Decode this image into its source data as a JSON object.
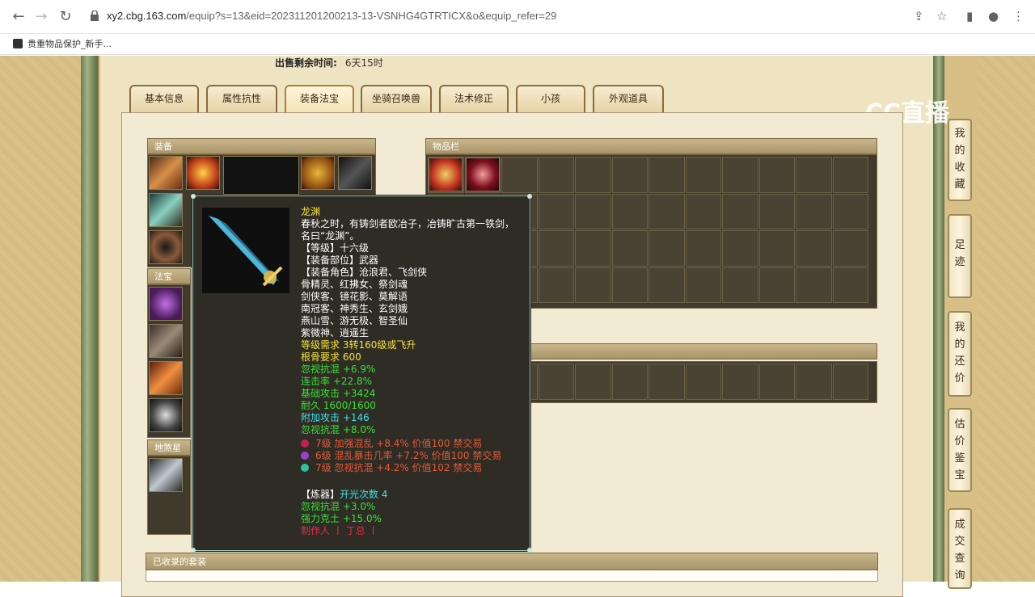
{
  "browser": {
    "url_host": "xy2.cbg.163.com",
    "url_path": "/equip?s=13&eid=202311201200213-13-VSNHG4GTRTICX&o&equip_refer=29",
    "bookmark": "贵重物品保护_新手..."
  },
  "sale": {
    "label": "出售剩余时间:",
    "value": "6天15时"
  },
  "tabs": [
    "基本信息",
    "属性抗性",
    "装备法宝",
    "坐骑召唤兽",
    "法术修正",
    "小孩",
    "外观道具"
  ],
  "panels": {
    "equipment": "装备",
    "fabao": "法宝",
    "disha": "地煞星",
    "inventory": "物品栏",
    "suits": "已收录的套装"
  },
  "tooltip": {
    "name": "龙渊",
    "desc_1": "春秋之时，有铸剑者欧冶子，冶铸旷古第一铁剑，",
    "desc_2": "名曰“龙渊”。",
    "level": "【等级】十六级",
    "slot": "【装备部位】武器",
    "roles": "【装备角色】沧浪君、飞剑侠",
    "roles_2": "骨精灵、红拂女、祭剑魂",
    "roles_3": "剑侠客、镜花影、莫解语",
    "roles_4": "南冠客、神秀生、玄剑娥",
    "roles_5": "燕山雪、游无极、智圣仙",
    "roles_6": "紫微神、逍遥生",
    "req_level": "等级需求 3转160级或飞升",
    "req_bone": "根骨要求 600",
    "attr_1": "忽视抗混 +6.9%",
    "attr_2": "连击率 +22.8%",
    "attr_3": "基础攻击 +3424",
    "attr_4": "耐久 1600/1600",
    "attr_5": "附加攻击 +146",
    "attr_6": "忽视抗混 +8.0%",
    "gem_1": "7级 加强混乱 +8.4% 价值100 禁交易",
    "gem_2": "6级 混乱暴击几率 +7.2% 价值100 禁交易",
    "gem_3": "7级 忽视抗混 +4.2% 价值102 禁交易",
    "refine_label": "【炼器】",
    "refine_value": "开光次数 4",
    "refine_1": "忽视抗混 +3.0%",
    "refine_2": "强力克土 +15.0%",
    "maker": "制作人 丨 丁总 丨"
  },
  "side": {
    "favorites": [
      "我",
      "的",
      "收",
      "藏"
    ],
    "footprint": [
      "足",
      "迹"
    ],
    "counter": [
      "我",
      "的",
      "还",
      "价"
    ],
    "appraise": [
      "估",
      "价",
      "鉴",
      "宝"
    ],
    "deals": [
      "成",
      "交",
      "查",
      "询"
    ]
  },
  "watermark": "CC直播",
  "colors": {
    "accent_tab": "#b07f2e",
    "tooltip_bg": "#2e2c24",
    "gem_red": "#e35a3a"
  }
}
